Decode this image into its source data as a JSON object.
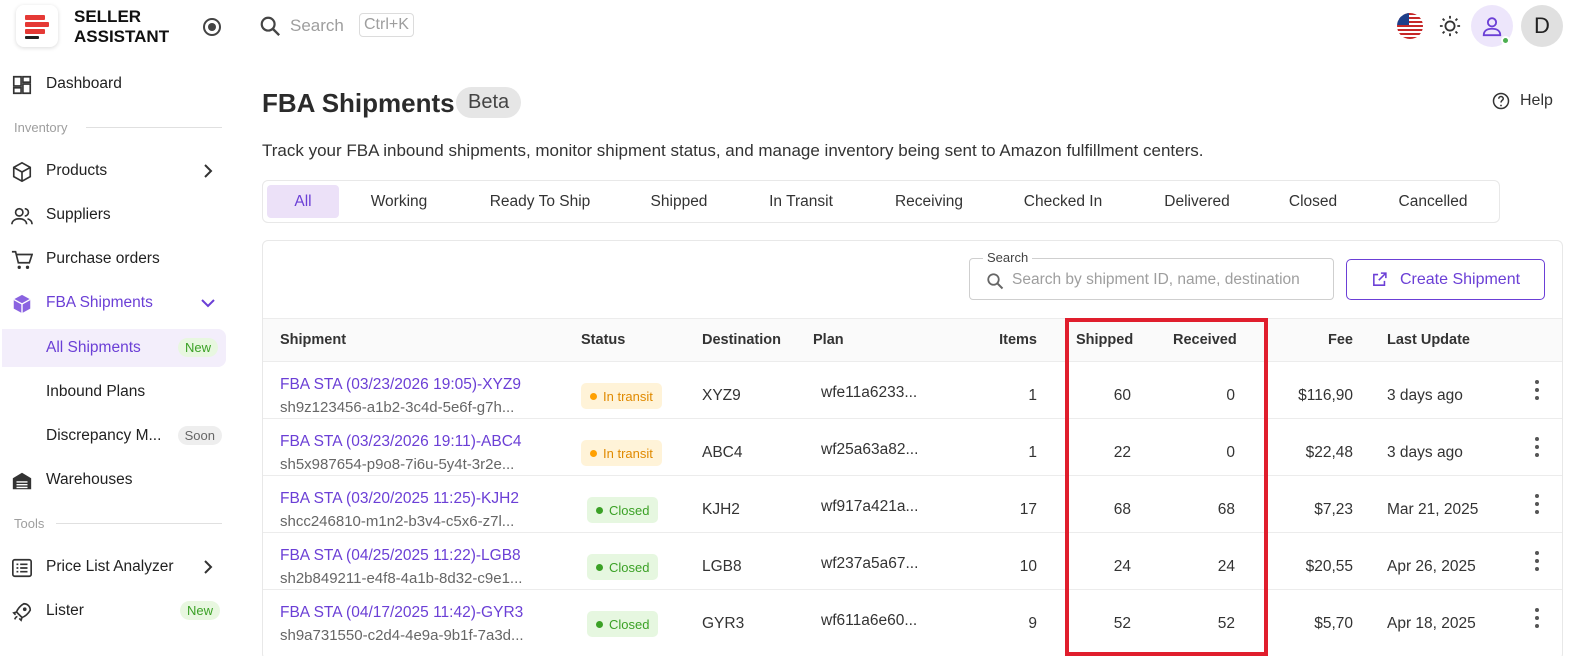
{
  "brand": {
    "line1": "SELLER",
    "line2": "ASSISTANT"
  },
  "topbar": {
    "search_placeholder": "Search",
    "shortcut": "Ctrl+K",
    "avatar_letter": "D"
  },
  "sidebar": {
    "dashboard": "Dashboard",
    "section_inventory": "Inventory",
    "products": "Products",
    "suppliers": "Suppliers",
    "purchase_orders": "Purchase orders",
    "fba_shipments": "FBA Shipments",
    "all_shipments": "All Shipments",
    "new_badge": "New",
    "inbound_plans": "Inbound Plans",
    "discrepancy": "Discrepancy M...",
    "soon_badge": "Soon",
    "warehouses": "Warehouses",
    "section_tools": "Tools",
    "price_list_analyzer": "Price List Analyzer",
    "lister": "Lister",
    "lister_badge": "New"
  },
  "header": {
    "title": "FBA Shipments",
    "beta": "Beta",
    "help": "Help",
    "description": "Track your FBA inbound shipments, monitor shipment status, and manage inventory being sent to Amazon fulfillment centers."
  },
  "tabs": [
    "All",
    "Working",
    "Ready To Ship",
    "Shipped",
    "In Transit",
    "Receiving",
    "Checked In",
    "Delivered",
    "Closed",
    "Cancelled"
  ],
  "toolbar": {
    "search_label": "Search",
    "search_placeholder": "Search by shipment ID, name, destination",
    "create_button": "Create Shipment"
  },
  "table": {
    "columns": [
      "Shipment",
      "Status",
      "Destination",
      "Plan",
      "Items",
      "Shipped",
      "Received",
      "Fee",
      "Last Update"
    ],
    "rows": [
      {
        "name": "FBA STA (03/23/2026 19:05)-XYZ9",
        "id": "sh9z123456-a1b2-3c4d-5e6f-g7h...",
        "status": "In transit",
        "destination": "XYZ9",
        "plan": "wfe11a6233...",
        "items": "1",
        "shipped": "60",
        "received": "0",
        "fee": "$116,90",
        "updated": "3 days ago"
      },
      {
        "name": "FBA STA (03/23/2026 19:11)-ABC4",
        "id": "sh5x987654-p9o8-7i6u-5y4t-3r2e...",
        "status": "In transit",
        "destination": "ABC4",
        "plan": "wf25a63a82...",
        "items": "1",
        "shipped": "22",
        "received": "0",
        "fee": "$22,48",
        "updated": "3 days ago"
      },
      {
        "name": "FBA STA (03/20/2025 11:25)-KJH2",
        "id": "shcc246810-m1n2-b3v4-c5x6-z7l...",
        "status": "Closed",
        "destination": "KJH2",
        "plan": "wf917a421a...",
        "items": "17",
        "shipped": "68",
        "received": "68",
        "fee": "$7,23",
        "updated": "Mar 21, 2025"
      },
      {
        "name": "FBA STA (04/25/2025 11:22)-LGB8",
        "id": "sh2b849211-e4f8-4a1b-8d32-c9e1...",
        "status": "Closed",
        "destination": "LGB8",
        "plan": "wf237a5a67...",
        "items": "10",
        "shipped": "24",
        "received": "24",
        "fee": "$20,55",
        "updated": "Apr 26, 2025"
      },
      {
        "name": "FBA STA (04/17/2025 11:42)-GYR3",
        "id": "sh9a731550-c2d4-4e9a-9b1f-7a3d...",
        "status": "Closed",
        "destination": "GYR3",
        "plan": "wf611a6e60...",
        "items": "9",
        "shipped": "52",
        "received": "52",
        "fee": "$5,70",
        "updated": "Apr 18, 2025"
      }
    ]
  },
  "colors": {
    "accent": "#6b3fd6",
    "highlight": "#e01e2d",
    "transit": "#ffa000",
    "closed": "#3ba126"
  }
}
